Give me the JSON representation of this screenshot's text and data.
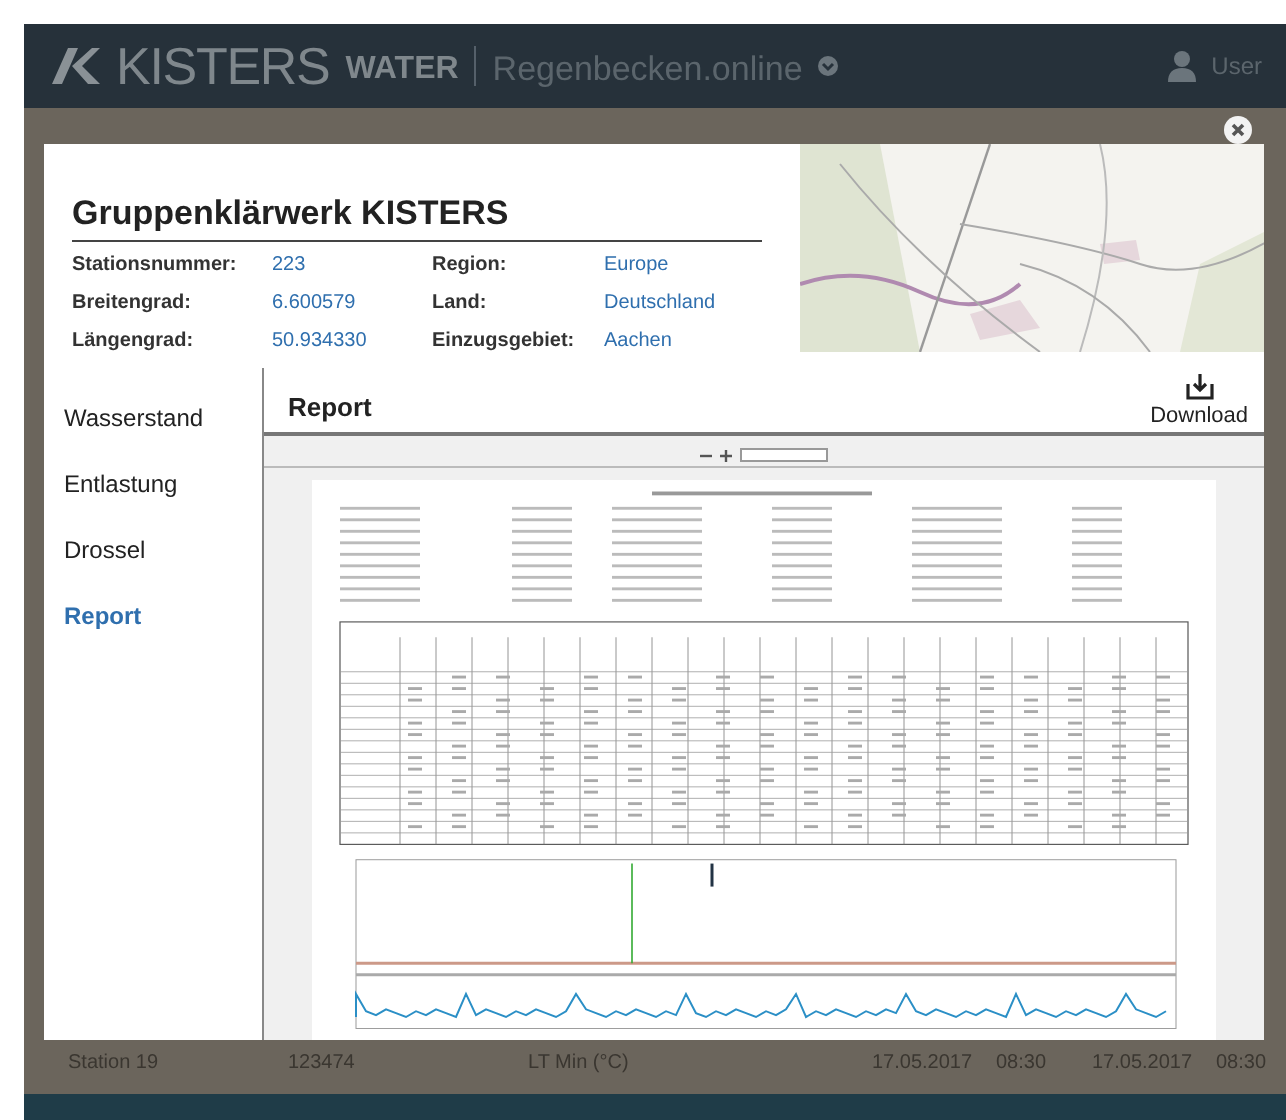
{
  "header": {
    "brand": "KISTERS",
    "product": "WATER",
    "app": "Regenbecken.online",
    "user": "User"
  },
  "background_row": [
    "Station 19",
    "123474",
    "LT Min (°C)",
    "17.05.2017",
    "08:30",
    "17.05.2017",
    "08:30"
  ],
  "dialog": {
    "title": "Gruppenklärwerk KISTERS",
    "fields": [
      {
        "label": "Stationsnummer:",
        "value": "223"
      },
      {
        "label": "Region:",
        "value": "Europe"
      },
      {
        "label": "Breitengrad:",
        "value": "6.600579"
      },
      {
        "label": "Land:",
        "value": "Deutschland"
      },
      {
        "label": "Längengrad:",
        "value": "50.934330"
      },
      {
        "label": "Einzugsgebiet:",
        "value": "Aachen"
      }
    ],
    "tabs": [
      {
        "label": "Wasserstand",
        "selected": false
      },
      {
        "label": "Entlastung",
        "selected": false
      },
      {
        "label": "Drossel",
        "selected": false
      },
      {
        "label": "Report",
        "selected": true
      }
    ],
    "panel": {
      "title": "Report",
      "download": "Download"
    }
  }
}
